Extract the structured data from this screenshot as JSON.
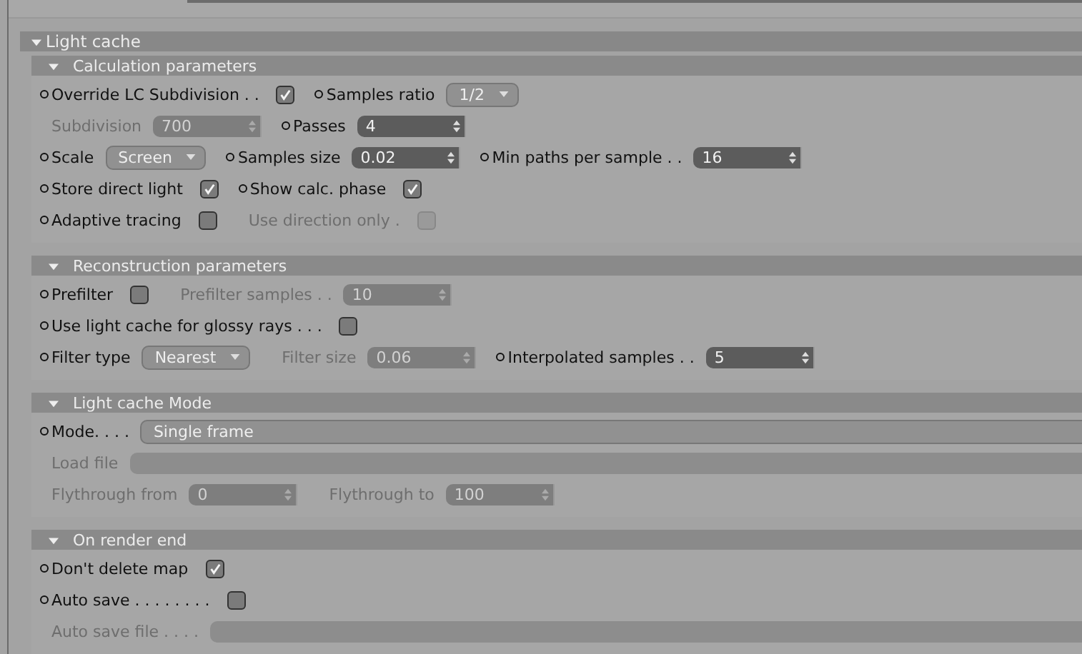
{
  "group": {
    "title": "Light cache",
    "expanded": true
  },
  "sections": [
    {
      "title": "Calculation parameters",
      "expanded": true,
      "rows": [
        {
          "items": [
            {
              "kind": "checkbox",
              "label": "Override LC Subdivision . .",
              "dot": true,
              "disabled": false,
              "checked": true
            },
            {
              "kind": "dropdown",
              "label": "Samples ratio",
              "dot": true,
              "disabled": false,
              "value": "1/2"
            }
          ]
        },
        {
          "items": [
            {
              "kind": "spinner",
              "label": "Subdivision",
              "dot": false,
              "disabled": true,
              "value": "700"
            },
            {
              "kind": "spinner",
              "label": "Passes",
              "dot": true,
              "disabled": false,
              "value": "4"
            }
          ]
        },
        {
          "items": [
            {
              "kind": "dropdown",
              "label": "Scale",
              "dot": true,
              "disabled": false,
              "value": "Screen"
            },
            {
              "kind": "spinner",
              "label": "Samples size",
              "dot": true,
              "disabled": false,
              "value": "0.02"
            },
            {
              "kind": "spinner",
              "label": "Min paths per sample . .",
              "dot": true,
              "disabled": false,
              "value": "16"
            }
          ]
        },
        {
          "items": [
            {
              "kind": "checkbox",
              "label": "Store direct light",
              "dot": true,
              "disabled": false,
              "checked": true
            },
            {
              "kind": "checkbox",
              "label": "Show calc. phase",
              "dot": true,
              "disabled": false,
              "checked": true
            }
          ]
        },
        {
          "items": [
            {
              "kind": "checkbox",
              "label": "Adaptive tracing",
              "dot": true,
              "disabled": false,
              "checked": false
            },
            {
              "kind": "checkbox",
              "label": "Use direction only .",
              "dot": false,
              "disabled": true,
              "checked": false
            }
          ]
        }
      ]
    },
    {
      "title": "Reconstruction parameters",
      "expanded": true,
      "rows": [
        {
          "items": [
            {
              "kind": "checkbox",
              "label": "Prefilter",
              "dot": true,
              "disabled": false,
              "checked": false
            },
            {
              "kind": "spinner",
              "label": "Prefilter samples . .",
              "dot": false,
              "disabled": true,
              "value": "10"
            }
          ]
        },
        {
          "items": [
            {
              "kind": "checkbox",
              "label": "Use light cache for glossy rays . . .",
              "dot": true,
              "disabled": false,
              "checked": false
            }
          ]
        },
        {
          "items": [
            {
              "kind": "dropdown",
              "label": "Filter type",
              "dot": true,
              "disabled": false,
              "value": "Nearest"
            },
            {
              "kind": "spinner",
              "label": "Filter size",
              "dot": false,
              "disabled": true,
              "value": "0.06"
            },
            {
              "kind": "spinner",
              "label": "Interpolated samples . .",
              "dot": true,
              "disabled": false,
              "value": "5"
            }
          ]
        }
      ]
    },
    {
      "title": "Light cache Mode",
      "expanded": true,
      "rows": [
        {
          "items": [
            {
              "kind": "wide-dropdown",
              "label": "Mode. . . .",
              "dot": true,
              "disabled": false,
              "value": "Single frame"
            }
          ]
        },
        {
          "items": [
            {
              "kind": "field",
              "label": "Load file",
              "dot": false,
              "disabled": true
            }
          ]
        },
        {
          "items": [
            {
              "kind": "spinner",
              "label": "Flythrough from",
              "dot": false,
              "disabled": true,
              "value": "0"
            },
            {
              "kind": "spinner",
              "label": "Flythrough to",
              "dot": false,
              "disabled": true,
              "value": "100"
            }
          ]
        }
      ]
    },
    {
      "title": "On render end",
      "expanded": true,
      "rows": [
        {
          "items": [
            {
              "kind": "checkbox",
              "label": "Don't delete map",
              "dot": true,
              "disabled": false,
              "checked": true
            }
          ]
        },
        {
          "items": [
            {
              "kind": "checkbox",
              "label": "Auto save . . . . . . . .",
              "dot": true,
              "disabled": false,
              "checked": false
            }
          ]
        },
        {
          "items": [
            {
              "kind": "field",
              "label": "Auto save file . . . .",
              "dot": false,
              "disabled": true
            }
          ]
        }
      ]
    }
  ]
}
